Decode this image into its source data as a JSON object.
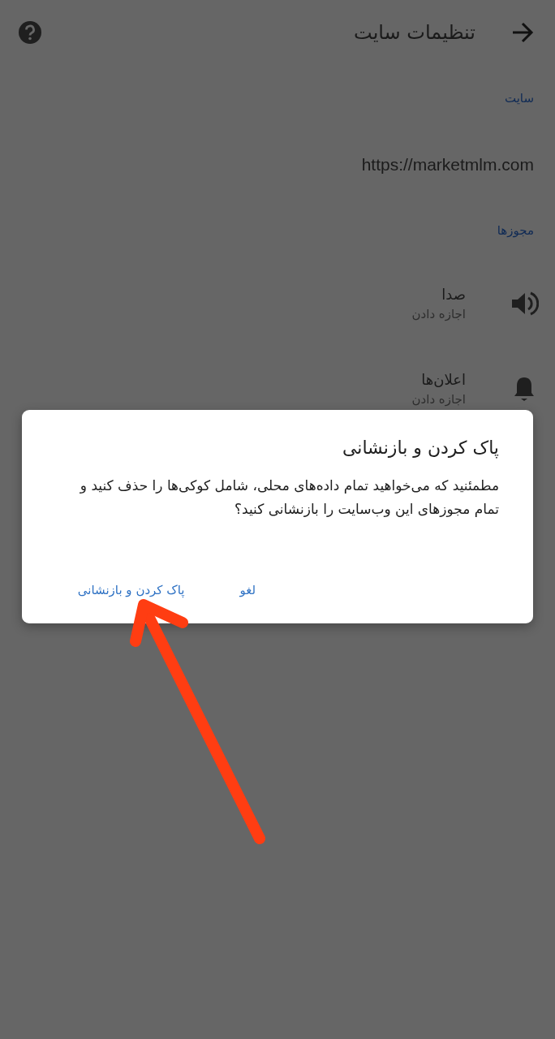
{
  "header": {
    "title": "تنظیمات سایت"
  },
  "sections": [
    {
      "label": "سایت",
      "items": [
        {
          "kind": "url",
          "title": "https://marketmlm.com"
        }
      ]
    },
    {
      "label": "مجوزها",
      "items": [
        {
          "kind": "sound",
          "title": "صدا",
          "subtitle": "اجازه دادن"
        },
        {
          "kind": "notifications",
          "title": "اعلان‌ها",
          "subtitle": "اجازه دادن"
        }
      ]
    }
  ],
  "dialog": {
    "title": "پاک کردن و بازنشانی",
    "message": "مطمئنید که می‌خواهید تمام داده‌های محلی، شامل کوکی‌ها را حذف کنید و تمام مجوزهای این وب‌سایت را بازنشانی کنید؟",
    "buttons": [
      {
        "label": "لغو"
      },
      {
        "label": "پاک کردن و بازنشانی"
      }
    ]
  }
}
